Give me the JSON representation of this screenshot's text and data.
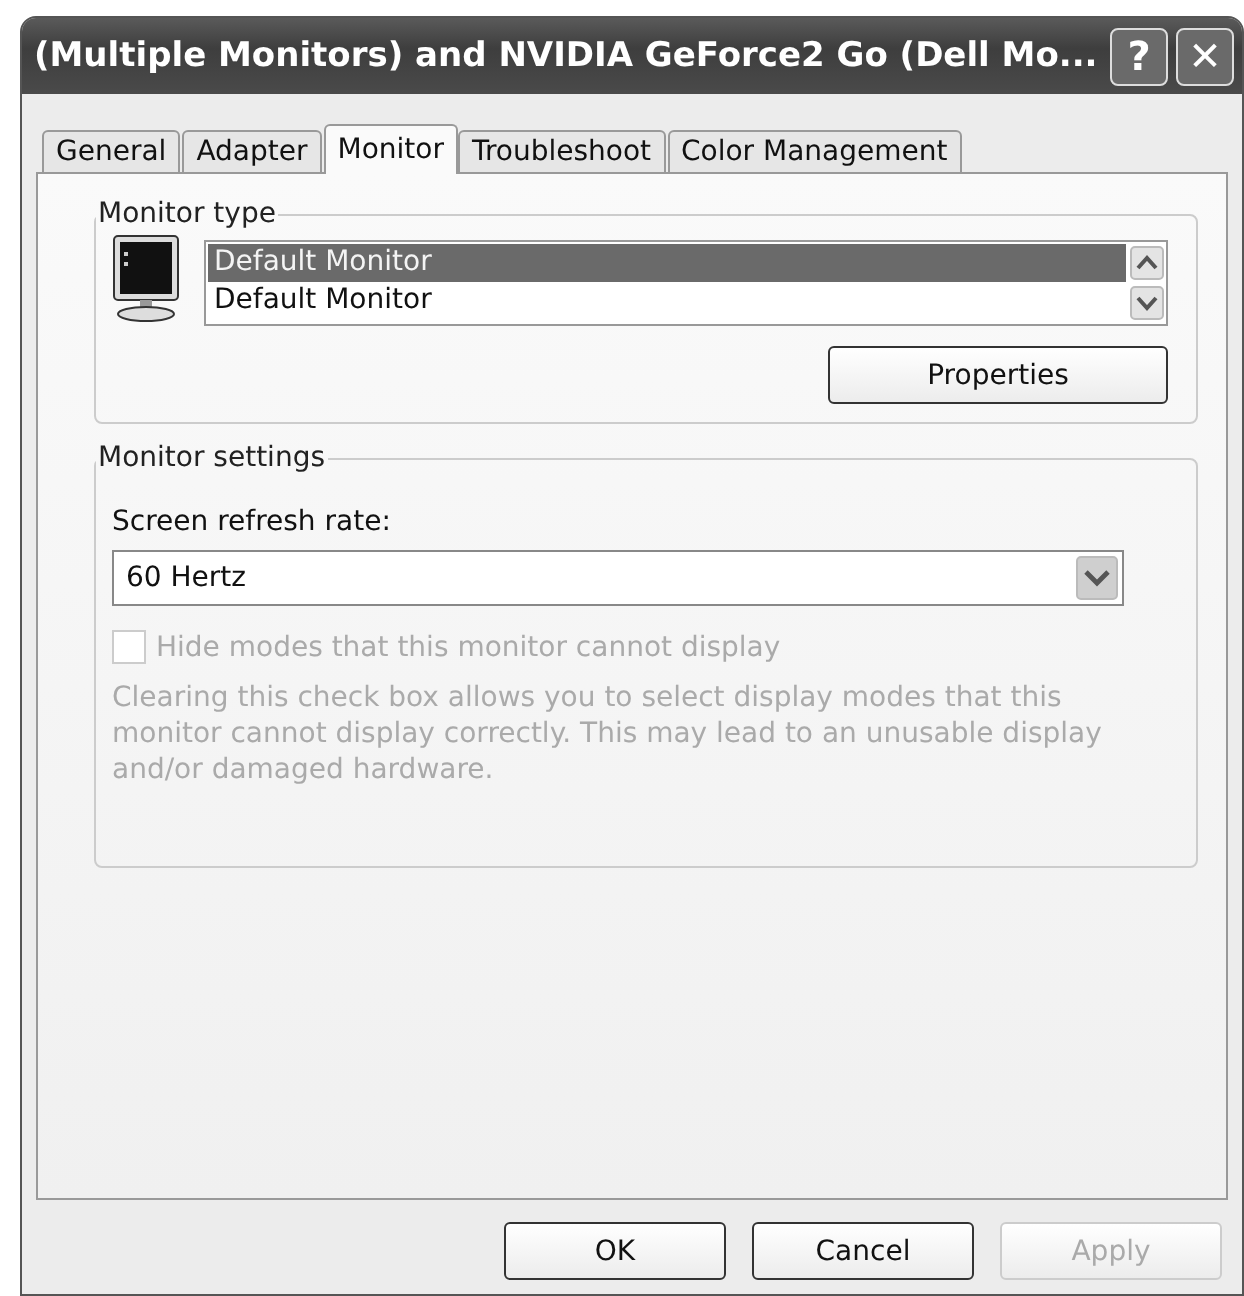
{
  "window": {
    "title": "(Multiple Monitors) and NVIDIA GeForce2 Go (Dell Mo...",
    "help_button": "?",
    "close_button": "✕"
  },
  "tabs": [
    {
      "label": "General",
      "selected": false
    },
    {
      "label": "Adapter",
      "selected": false
    },
    {
      "label": "Monitor",
      "selected": true
    },
    {
      "label": "Troubleshoot",
      "selected": false
    },
    {
      "label": "Color Management",
      "selected": false
    }
  ],
  "monitor_type": {
    "label": "Monitor type",
    "items": [
      {
        "text": "Default Monitor",
        "selected": true
      },
      {
        "text": "Default Monitor",
        "selected": false
      }
    ],
    "properties_button": {
      "label": "Properties"
    }
  },
  "monitor_settings": {
    "label": "Monitor settings",
    "refresh_label": {
      "text": "Screen refresh rate:"
    },
    "refresh_rate": "60 Hertz",
    "hide_modes": {
      "label": "Hide modes that this monitor cannot display",
      "checked": false,
      "disabled": true
    },
    "description": "Clearing this check box allows you to select display modes that this monitor cannot display correctly. This may lead to an unusable display and/or damaged hardware.",
    "description_disabled": true
  },
  "buttons": [
    {
      "label": "OK",
      "disabled": false
    },
    {
      "label": "Cancel",
      "disabled": false
    },
    {
      "label": "Apply",
      "disabled": true
    }
  ]
}
